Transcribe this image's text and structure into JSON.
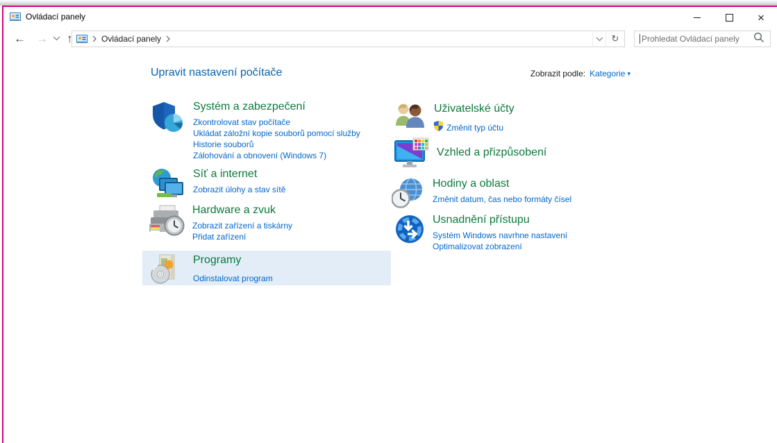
{
  "window": {
    "title": "Ovládací panely"
  },
  "icons": {
    "app": "control-panel",
    "back": "←",
    "forward": "→",
    "up": "↑",
    "refresh": "↻",
    "close": "×",
    "dropdown_arrow": "▾",
    "search": "magnifier"
  },
  "breadcrumb": {
    "location": "Ovládací panely"
  },
  "search": {
    "placeholder": "Prohledat Ovládací panely"
  },
  "header": {
    "title": "Upravit nastavení počítače",
    "view_by_label": "Zobrazit podle:",
    "view_by_value": "Kategorie"
  },
  "categories": {
    "left": [
      {
        "title": "Systém a zabezpečení",
        "icon": "security-shield-icon",
        "links": [
          "Zkontrolovat stav počítače",
          "Ukládat záložní kopie souborů pomocí služby Historie souborů",
          "Zálohování a obnovení (Windows 7)"
        ]
      },
      {
        "title": "Síť a internet",
        "icon": "network-icon",
        "links": [
          "Zobrazit úlohy a stav sítě"
        ]
      },
      {
        "title": "Hardware a zvuk",
        "icon": "printer-icon",
        "links": [
          "Zobrazit zařízení a tiskárny",
          "Přidat zařízení"
        ]
      },
      {
        "title": "Programy",
        "icon": "program-box-icon",
        "highlighted": true,
        "links": [
          "Odinstalovat program"
        ]
      }
    ],
    "right": [
      {
        "title": "Uživatelské účty",
        "icon": "users-icon",
        "links": [
          "Změnit typ účtu"
        ],
        "link_has_uac_shield": true
      },
      {
        "title": "Vzhled a přizpůsobení",
        "icon": "personalization-icon",
        "links": []
      },
      {
        "title": "Hodiny a oblast",
        "icon": "clock-globe-icon",
        "links": [
          "Změnit datum, čas nebo formáty čísel"
        ]
      },
      {
        "title": "Usnadnění přístupu",
        "icon": "ease-of-access-icon",
        "links": [
          "Systém Windows navrhne nastavení",
          "Optimalizovat zobrazení"
        ]
      }
    ]
  },
  "colors": {
    "category_title_green": "#0b7a3b",
    "task_link_blue": "#0066cc",
    "page_title_blue": "#0063b1",
    "window_border_pink": "#d5007f",
    "highlight_bg": "#e2edf8"
  }
}
